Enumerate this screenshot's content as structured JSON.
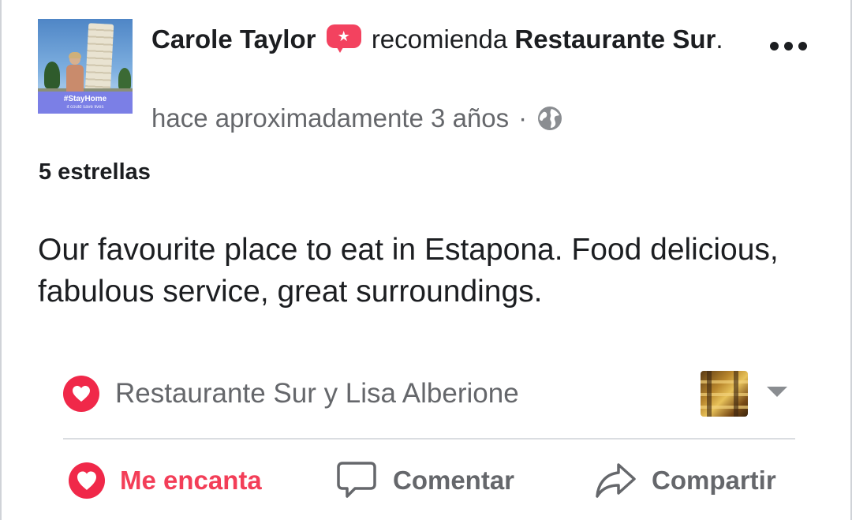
{
  "post": {
    "author": "Carole Taylor",
    "verb": "recomienda",
    "page_name": "Restaurante Sur",
    "period": ".",
    "timestamp": "hace aproximadamente 3 años",
    "separator": "·",
    "privacy_icon": "globe-icon",
    "avatar": {
      "banner_title": "#StayHome",
      "banner_sub": "it could save lives"
    },
    "rating_label": "5 estrellas",
    "review_text": "Our favourite place to eat in Estapona. Food delicious, fabulous service, great surroundings."
  },
  "reactions": {
    "icon": "heart-icon",
    "names": "Restaurante Sur y Lisa Alberione"
  },
  "actions": {
    "like_label": "Me encanta",
    "comment_label": "Comentar",
    "share_label": "Compartir"
  },
  "colors": {
    "love": "#f33e58",
    "text_primary": "#1c1e21",
    "text_secondary": "#65676b",
    "recommend_badge": "#f3425f"
  }
}
